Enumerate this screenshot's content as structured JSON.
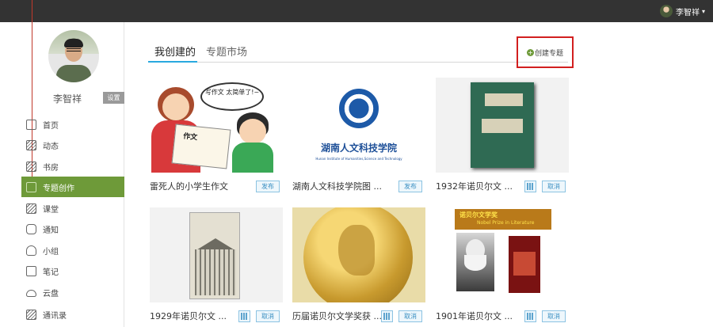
{
  "topbar": {
    "user_name": "李智祥",
    "caret": "▾"
  },
  "sidebar": {
    "profile_name": "李智祥",
    "settings_label": "设置",
    "items": [
      {
        "label": "首页",
        "icon": "home-icon"
      },
      {
        "label": "动态",
        "icon": "feed-icon"
      },
      {
        "label": "书房",
        "icon": "study-icon"
      },
      {
        "label": "专题创作",
        "icon": "topic-icon",
        "active": true
      },
      {
        "label": "课堂",
        "icon": "class-icon"
      },
      {
        "label": "通知",
        "icon": "notice-icon"
      },
      {
        "label": "小组",
        "icon": "group-icon"
      },
      {
        "label": "笔记",
        "icon": "note-icon"
      },
      {
        "label": "云盘",
        "icon": "cloud-icon"
      },
      {
        "label": "通讯录",
        "icon": "contacts-icon"
      }
    ]
  },
  "main": {
    "tabs": [
      {
        "label": "我创建的",
        "active": true
      },
      {
        "label": "专题市场",
        "active": false
      }
    ],
    "create_label": "创建专题",
    "cards": [
      {
        "title": "雷死人的小学生作文",
        "action": "发布",
        "image_text": {
          "bubble": "写作文 太简单了!~",
          "paper": "作文"
        }
      },
      {
        "title": "湖南人文科技学院图 ...",
        "action": "发布",
        "image_text": {
          "school": "湖南人文科技学院",
          "school_en": "Hunan Institute of Humanities,Science and Technology"
        }
      },
      {
        "title": "1932年诺贝尔文 ...",
        "action": "取消",
        "qr": true
      },
      {
        "title": "1929年诺贝尔文 ...",
        "action": "取消",
        "qr": true
      },
      {
        "title": "历届诺贝尔文学奖获 ...",
        "action": "取消",
        "qr": true
      },
      {
        "title": "1901年诺贝尔文 ...",
        "action": "取消",
        "qr": true,
        "image_text": {
          "banner": "诺贝尔文学奖",
          "banner_en": "Nobel Prize in Literature"
        }
      }
    ]
  },
  "colors": {
    "topbar": "#333333",
    "active_nav": "#6e9a39",
    "tab_underline": "#29a9df",
    "highlight_border": "#d21f1f"
  }
}
